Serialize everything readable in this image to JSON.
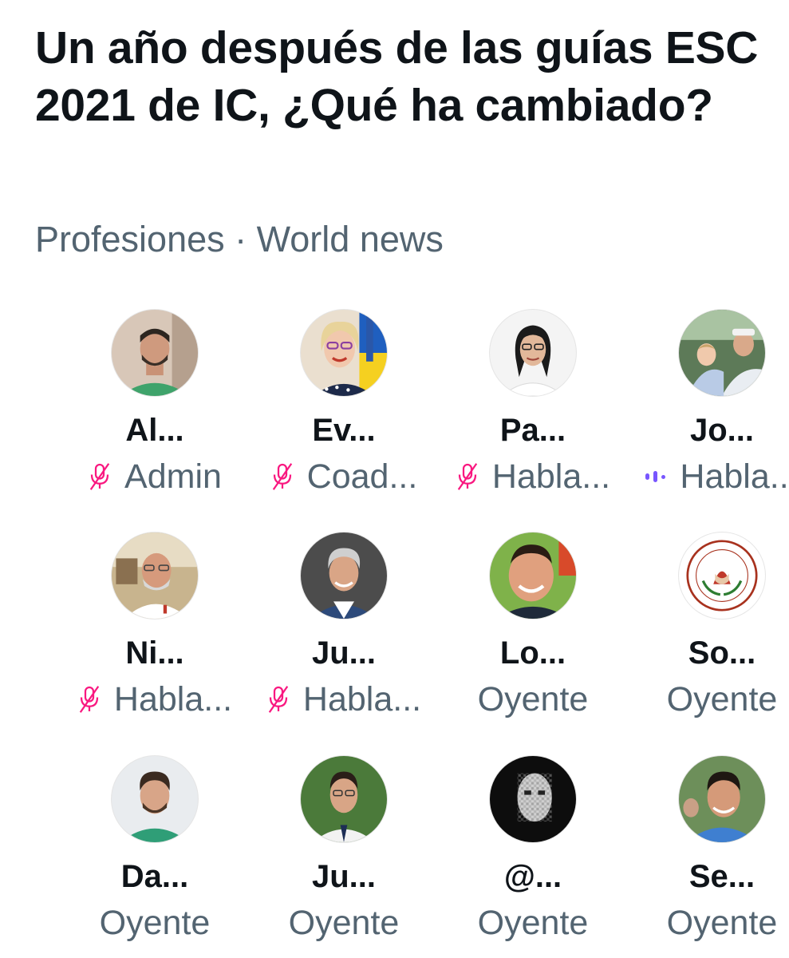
{
  "space": {
    "title": "Un año después de las guías ESC 2021 de IC, ¿Qué ha cambiado?",
    "topic": "Profesiones · World news"
  },
  "colors": {
    "muted_mic": "#f91880",
    "speaking": "#7856ff",
    "secondary_text": "#536471"
  },
  "participants": [
    {
      "name": "Al...",
      "role": "Admin",
      "status": "muted"
    },
    {
      "name": "Ev...",
      "role": "Coad...",
      "status": "muted"
    },
    {
      "name": "Pa...",
      "role": "Habla...",
      "status": "muted"
    },
    {
      "name": "Jo...",
      "role": "Habla...",
      "status": "speaking"
    },
    {
      "name": "Ni...",
      "role": "Habla...",
      "status": "muted"
    },
    {
      "name": "Ju...",
      "role": "Habla...",
      "status": "muted"
    },
    {
      "name": "Lo...",
      "role": "Oyente",
      "status": "none"
    },
    {
      "name": "So...",
      "role": "Oyente",
      "status": "none"
    },
    {
      "name": "Da...",
      "role": "Oyente",
      "status": "none"
    },
    {
      "name": "Ju...",
      "role": "Oyente",
      "status": "none"
    },
    {
      "name": "@...",
      "role": "Oyente",
      "status": "none"
    },
    {
      "name": "Se...",
      "role": "Oyente",
      "status": "none"
    }
  ]
}
